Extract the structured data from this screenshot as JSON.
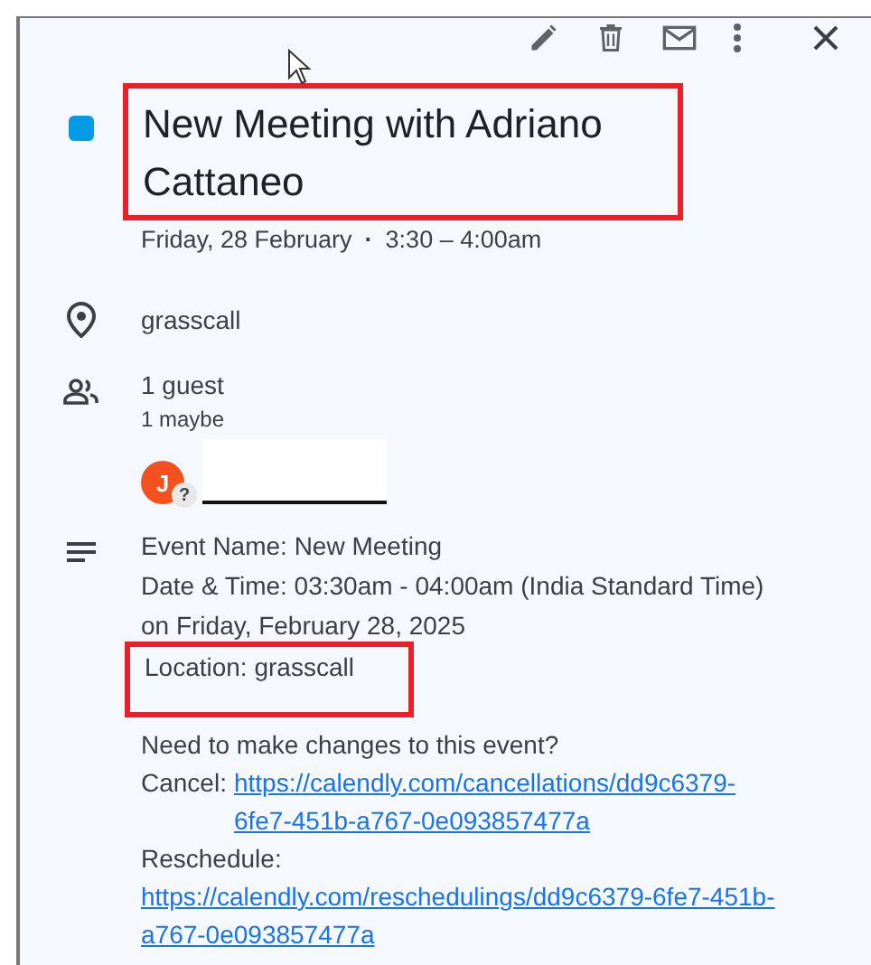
{
  "toolbar": [
    {
      "kind": "edit"
    },
    {
      "kind": "delete"
    },
    {
      "kind": "email"
    },
    {
      "kind": "more"
    },
    {
      "kind": "close"
    }
  ],
  "event": {
    "color": "#039be5",
    "title": "New Meeting with Adriano Cattaneo",
    "date": "Friday, 28 February",
    "separator": "·",
    "time": "3:30 – 4:00am"
  },
  "location": "grasscall",
  "guests": {
    "count": "1 guest",
    "summary": "1 maybe",
    "list": [
      {
        "initial": "J",
        "color": "#f4511e",
        "response": "?"
      }
    ]
  },
  "description": {
    "lines": [
      "Event Name: New Meeting",
      "Date & Time: 03:30am - 04:00am (India Standard Time) on Friday, February 28, 2025"
    ],
    "highlighted_line": "Location: grasscall",
    "question": "Need to make changes to this event?",
    "links": [
      {
        "label": "Cancel:",
        "url": "https://calendly.com/cancellations/dd9c6379-6fe7-451b-a767-0e093857477a",
        "kind": "inline"
      },
      {
        "label": "Reschedule:",
        "url": "https://calendly.com/reschedulings/dd9c6379-6fe7-451b-a767-0e093857477a",
        "kind": "block"
      }
    ]
  }
}
